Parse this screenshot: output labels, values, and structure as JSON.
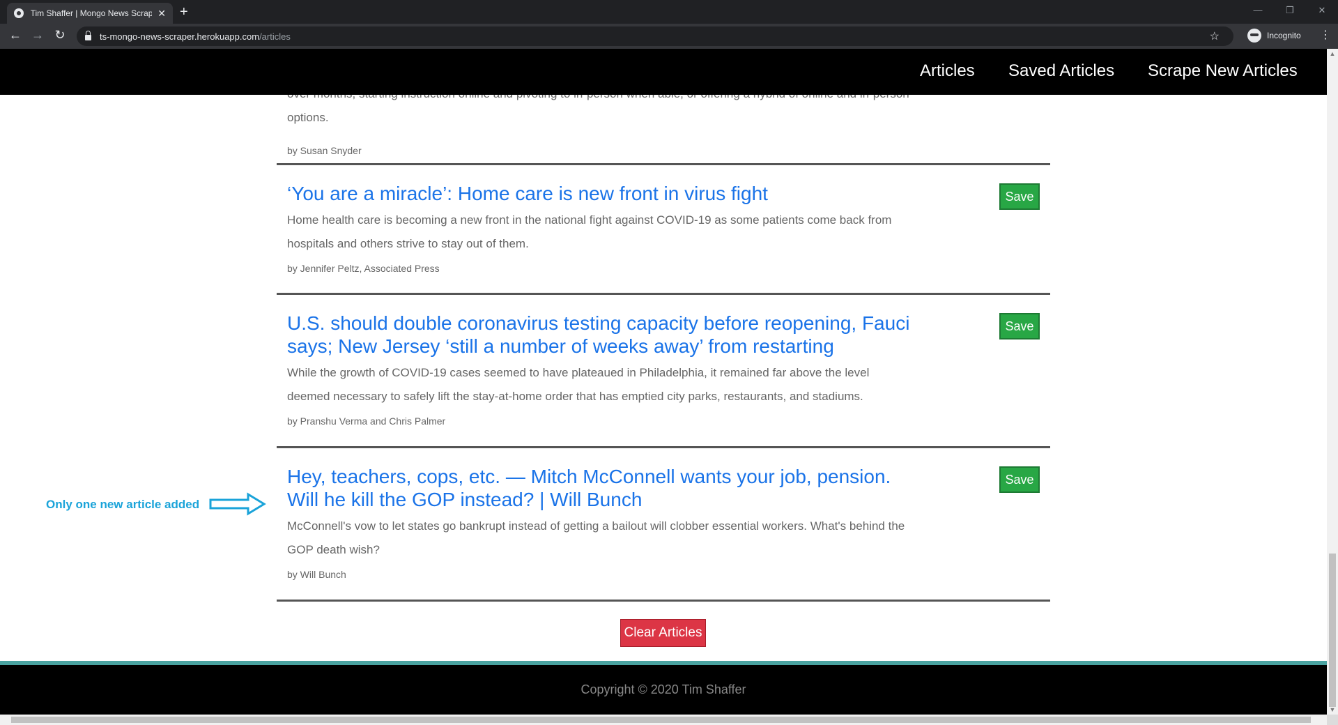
{
  "browser": {
    "tab_title": "Tim Shaffer | Mongo News Scraper",
    "url_host": "ts-mongo-news-scraper.herokuapp.com",
    "url_path": "/articles",
    "profile_label": "Incognito"
  },
  "nav": {
    "links": [
      "Articles",
      "Saved Articles",
      "Scrape New Articles"
    ]
  },
  "articles": [
    {
      "partial_summary": "over months, starting instruction online and pivoting to in-person when able, or offering a hybrid of online and in-person options.",
      "author": "by Susan Snyder"
    },
    {
      "title": "‘You are a miracle’: Home care is new front in virus fight",
      "summary": "Home health care is becoming a new front in the national fight against COVID-19 as some patients come back from hospitals and others strive to stay out of them.",
      "author": "by Jennifer Peltz, Associated Press",
      "save_label": "Save"
    },
    {
      "title": "U.S. should double coronavirus testing capacity before reopening, Fauci says; New Jersey ‘still a number of weeks away’ from restarting",
      "summary": "While the growth of COVID-19 cases seemed to have plateaued in Philadelphia, it remained far above the level deemed necessary to safely lift the stay-at-home order that has emptied city parks, restaurants, and stadiums.",
      "author": "by Pranshu Verma and Chris Palmer",
      "save_label": "Save"
    },
    {
      "title": "Hey, teachers, cops, etc. — Mitch McConnell wants your job, pension. Will he kill the GOP instead? | Will Bunch",
      "summary": "McConnell's vow to let states go bankrupt instead of getting a bailout will clobber essential workers. What's behind the GOP death wish?",
      "author": "by Will Bunch",
      "save_label": "Save"
    }
  ],
  "clear_label": "Clear Articles",
  "footer": {
    "copyright": "Copyright © 2020 Tim Shaffer"
  },
  "annotation": "Only one new article added",
  "colors": {
    "link": "#1a73e8",
    "save": "#28a745",
    "clear": "#dc3545",
    "annotation": "#1aa3d9"
  }
}
